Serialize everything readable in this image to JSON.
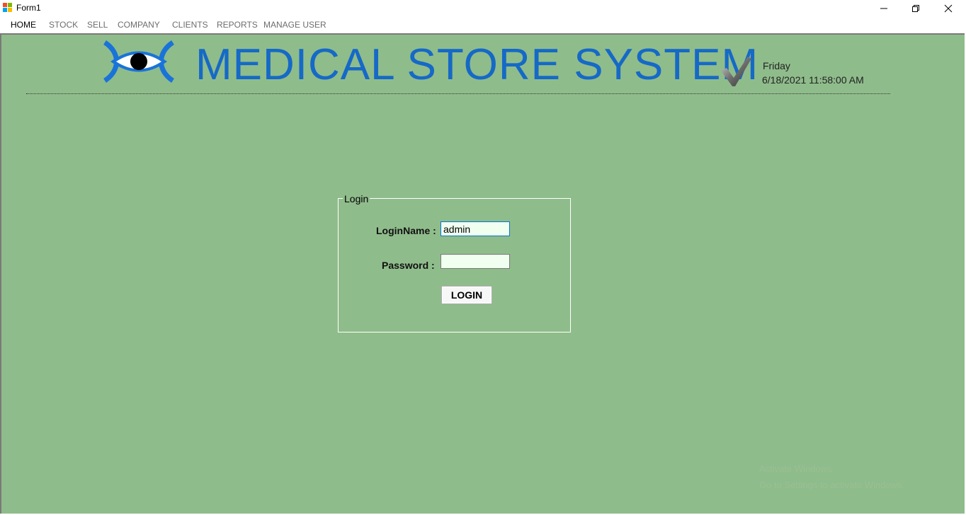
{
  "window": {
    "title": "Form1"
  },
  "menu": {
    "items": [
      {
        "label": "HOME"
      },
      {
        "label": "STOCK"
      },
      {
        "label": "SELL"
      },
      {
        "label": "COMPANY"
      },
      {
        "label": "CLIENTS"
      },
      {
        "label": "REPORTS"
      },
      {
        "label": "MANAGE USER"
      }
    ]
  },
  "header": {
    "title": "MEDICAL STORE SYSTEM",
    "day": "Friday",
    "datetime": "6/18/2021 11:58:00 AM"
  },
  "login": {
    "group_title": "Login",
    "name_label": "LoginName :",
    "name_value": "admin",
    "password_label": "Password :",
    "password_value": "",
    "button_label": "LOGIN"
  },
  "watermark": {
    "line1": "Activate Windows",
    "line2": "Go to Settings to activate Windows."
  },
  "colors": {
    "background": "#8fbc8b",
    "title_blue": "#1569c7",
    "textbox_bg": "#f0fff0"
  }
}
